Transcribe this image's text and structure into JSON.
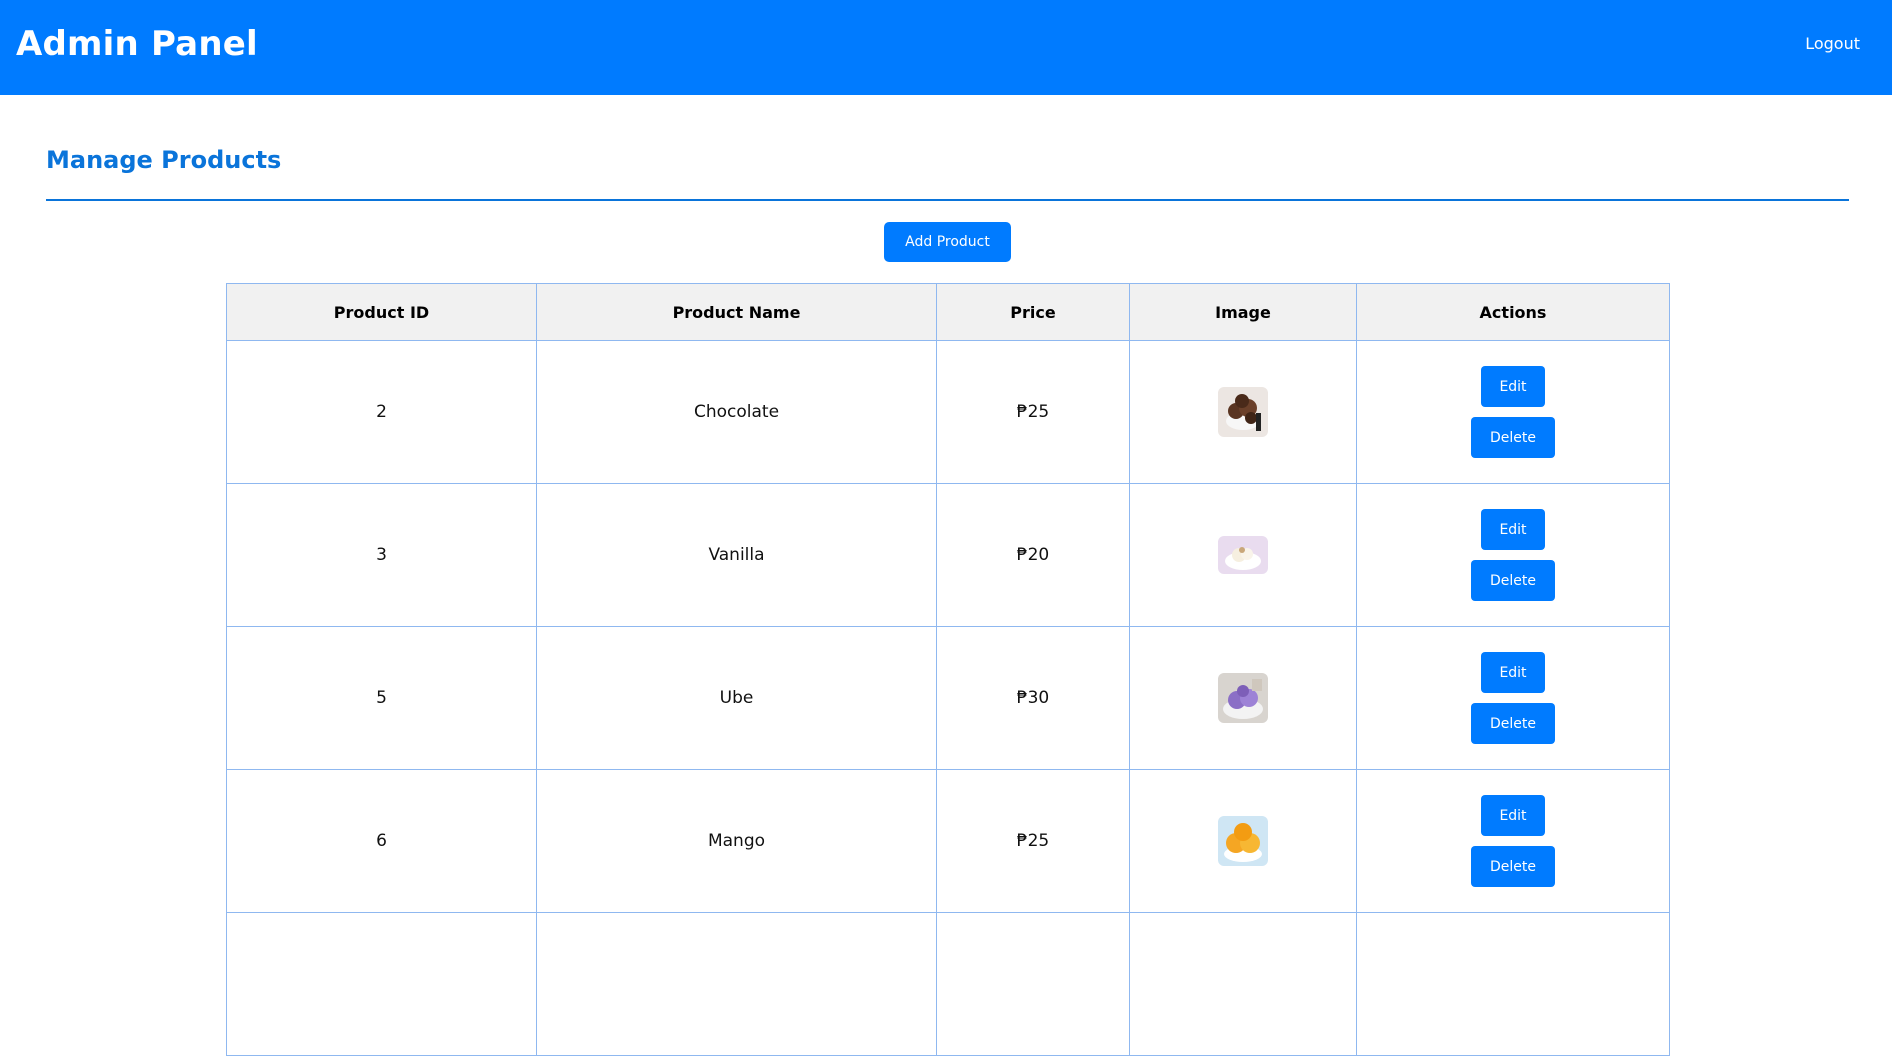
{
  "header": {
    "title": "Admin Panel",
    "logout_label": "Logout"
  },
  "main": {
    "title": "Manage Products",
    "add_button_label": "Add Product"
  },
  "table": {
    "headers": [
      "Product ID",
      "Product Name",
      "Price",
      "Image",
      "Actions"
    ],
    "rows": [
      {
        "id": "2",
        "name": "Chocolate",
        "price": "₱25",
        "image_icon": "chocolate-ice-cream-thumbnail",
        "edit_label": "Edit",
        "delete_label": "Delete"
      },
      {
        "id": "3",
        "name": "Vanilla",
        "price": "₱20",
        "image_icon": "vanilla-ice-cream-thumbnail",
        "edit_label": "Edit",
        "delete_label": "Delete"
      },
      {
        "id": "5",
        "name": "Ube",
        "price": "₱30",
        "image_icon": "ube-ice-cream-thumbnail",
        "edit_label": "Edit",
        "delete_label": "Delete"
      },
      {
        "id": "6",
        "name": "Mango",
        "price": "₱25",
        "image_icon": "mango-ice-cream-thumbnail",
        "edit_label": "Edit",
        "delete_label": "Delete"
      }
    ]
  },
  "colors": {
    "primary": "#007bff",
    "title_blue": "#0a74da",
    "table_border": "#8fb8f0",
    "header_bg": "#f1f1f1"
  }
}
